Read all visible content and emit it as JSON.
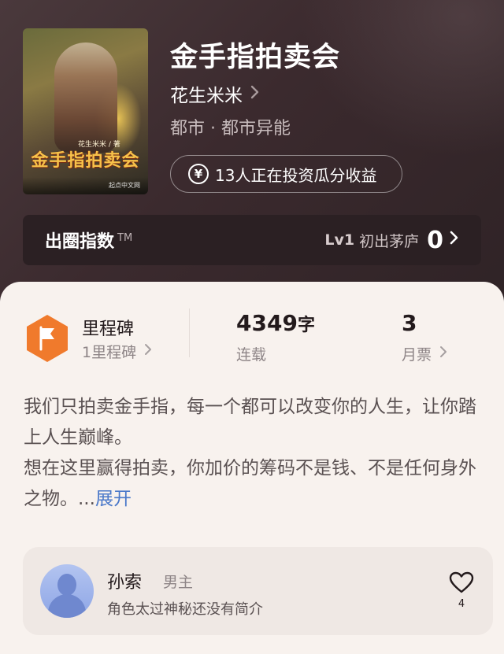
{
  "book": {
    "title": "金手指拍卖会",
    "author": "花生米米",
    "genre": "都市 · 都市异能",
    "invest_text": "13人正在投资瓜分收益",
    "cover": {
      "title_text": "金手指拍卖会",
      "author_text": "花生米米 / 著",
      "publisher_text": "起点中文网"
    }
  },
  "influence": {
    "title": "出圈指数",
    "tm": "TM",
    "level": "Lv1",
    "level_name": "初出茅庐",
    "score": "0"
  },
  "stats": {
    "milestone": {
      "label": "里程碑",
      "sub": "1里程碑"
    },
    "words": {
      "value": "4349",
      "unit": "字",
      "sub": "连载"
    },
    "monthly_ticket": {
      "value": "3",
      "sub": "月票"
    }
  },
  "synopsis": {
    "line1": "我们只拍卖金手指，每一个都可以改变你的人生，让你踏上人生巅峰。",
    "line2": "想在这里赢得拍卖，你加价的筹码不是钱、不是任何身外之物。...",
    "expand": "展开"
  },
  "character": {
    "name": "孙索",
    "role": "男主",
    "desc": "角色太过神秘还没有简介",
    "likes": "4"
  },
  "icons": {
    "author_chevron": "chevron-right-icon",
    "yen": "yen-circle-icon",
    "milestone": "flag-hexagon-icon",
    "heart": "heart-outline-icon"
  },
  "colors": {
    "hero_bg": "#3e2d2f",
    "card_bg": "#f8f2ee",
    "milestone_orange": "#f07a2c",
    "expand_link": "#4a78c9"
  }
}
